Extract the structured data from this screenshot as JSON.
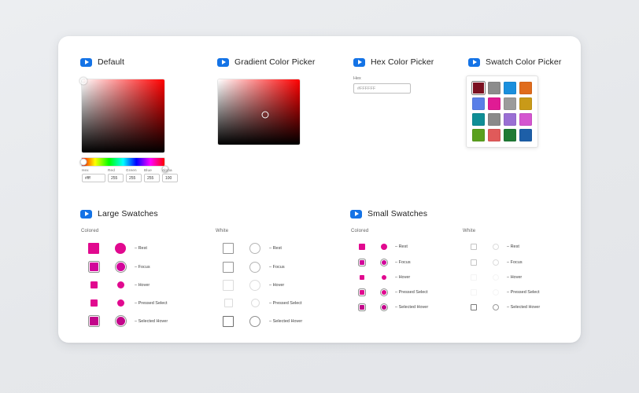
{
  "theme": {
    "page_bg": "#e8e9ec",
    "card_bg": "#ffffff",
    "accent_blue": "#1473e6",
    "magenta": "#e1098f",
    "magenta_dark": "#c2058a"
  },
  "sections": {
    "default_picker": {
      "title": "Default"
    },
    "gradient_picker": {
      "title": "Gradient Color Picker"
    },
    "hex_picker": {
      "title": "Hex Color Picker",
      "field_label": "Hex",
      "field_value": "#FFFFFF"
    },
    "swatch_picker": {
      "title": "Swatch Color Picker"
    },
    "large_swatches": {
      "title": "Large Swatches"
    },
    "small_swatches": {
      "title": "Small Swatches"
    }
  },
  "color_fields": [
    {
      "label": "Hex",
      "value": "#fff"
    },
    {
      "label": "Red",
      "value": "255"
    },
    {
      "label": "Green",
      "value": "255"
    },
    {
      "label": "Blue",
      "value": "255"
    },
    {
      "label": "Alpha",
      "value": "100"
    }
  ],
  "swatch_grid": {
    "colors": [
      "#7b1021",
      "#8c8c8c",
      "#1a8fdd",
      "#e06c1c",
      "#5a7fe8",
      "#e01b94",
      "#9b9b9b",
      "#c99a18",
      "#0f8e96",
      "#8a8a8a",
      "#9a6fd4",
      "#d455d0",
      "#5aa01e",
      "#e05a5a",
      "#1f7a35",
      "#1d5fa8"
    ],
    "selected_index": 0
  },
  "swatch_states": {
    "colored_header": "Colored",
    "white_header": "White",
    "rows": [
      {
        "label": "– Rest"
      },
      {
        "label": "– Focus"
      },
      {
        "label": "– Hover"
      },
      {
        "label": "– Pressed Select"
      },
      {
        "label": "– Selected Hover"
      }
    ]
  }
}
